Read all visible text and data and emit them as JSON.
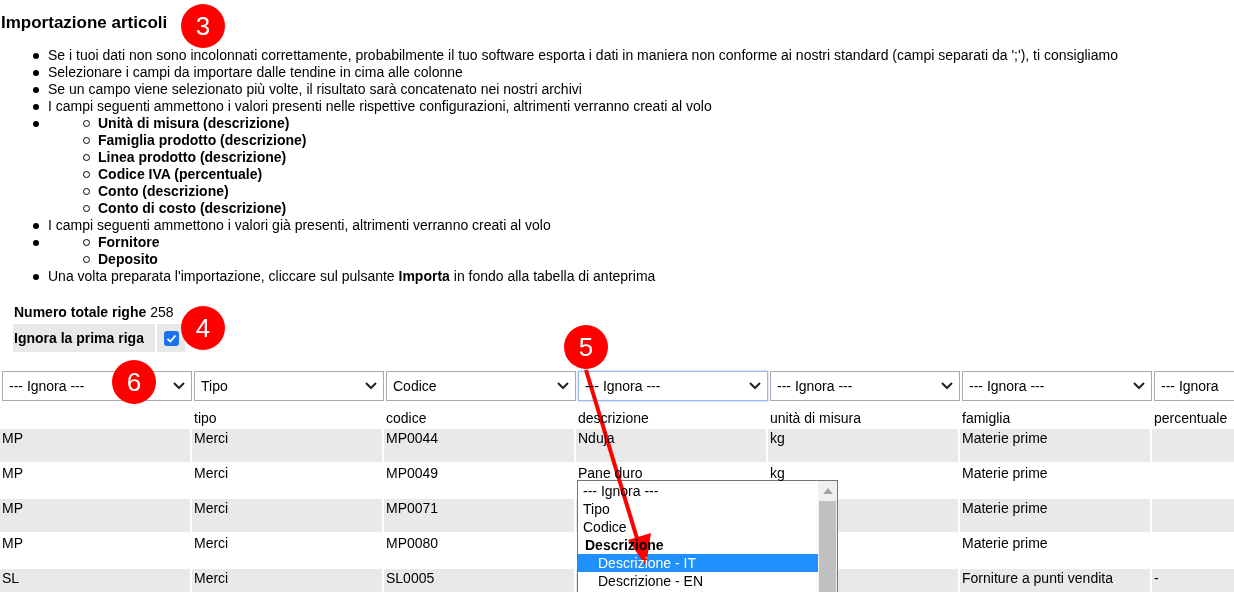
{
  "title": "Importazione articoli",
  "instructions": [
    {
      "kind": "text",
      "text": "Se i tuoi dati non sono incolonnati correttamente, probabilmente il tuo software esporta i dati in maniera non conforme ai nostri standard (campi separati da ';'), ti consigliamo"
    },
    {
      "kind": "text",
      "text": "Selezionare i campi da importare dalle tendine in cima alle colonne"
    },
    {
      "kind": "text",
      "text": "Se un campo viene selezionato più volte, il risultato sarà concatenato nei nostri archivi"
    },
    {
      "kind": "text",
      "text": "I campi seguenti ammettono i valori presenti nelle rispettive configurazioni, altrimenti verranno creati al volo"
    },
    {
      "kind": "sublist",
      "children": [
        "Unità di misura (descrizione)",
        "Famiglia prodotto (descrizione)",
        "Linea prodotto (descrizione)",
        "Codice IVA (percentuale)",
        "Conto (descrizione)",
        "Conto di costo (descrizione)"
      ]
    },
    {
      "kind": "text",
      "text": "I campi seguenti ammettono i valori già presenti, altrimenti verranno creati al volo"
    },
    {
      "kind": "sublist",
      "children": [
        "Fornitore",
        "Deposito"
      ]
    },
    {
      "kind": "text",
      "text": "Una volta preparata l'importazione, cliccare sul pulsante **Importa** in fondo alla tabella di anteprima"
    }
  ],
  "total_rows": {
    "label": "Numero totale righe",
    "value": "258"
  },
  "skip_first_row": {
    "label": "Ignora la prima riga",
    "checked": true
  },
  "columns": [
    {
      "select": "--- Ignora ---",
      "focused": false
    },
    {
      "select": "Tipo",
      "focused": false,
      "header": "tipo"
    },
    {
      "select": "Codice",
      "focused": false,
      "header": "codice"
    },
    {
      "select": "--- Ignora ---",
      "focused": true,
      "header": "descrizione"
    },
    {
      "select": "--- Ignora ---",
      "focused": false,
      "header": "unità di misura"
    },
    {
      "select": "--- Ignora ---",
      "focused": false,
      "header": "famiglia"
    },
    {
      "select": "--- Ignora",
      "focused": false,
      "header": "percentuale"
    }
  ],
  "rows": [
    [
      "MP",
      "Merci",
      "MP0044",
      "Nduja",
      "kg",
      "Materie prime",
      null
    ],
    [
      "MP",
      "Merci",
      "MP0049",
      "Pane duro",
      "kg",
      "Materie prime",
      null
    ],
    [
      "MP",
      "Merci",
      "MP0071",
      null,
      null,
      "Materie prime",
      null
    ],
    [
      "MP",
      "Merci",
      "MP0080",
      null,
      null,
      "Materie prime",
      null
    ],
    [
      "SL",
      "Merci",
      "SL0005",
      null,
      null,
      "Forniture a punti vendita",
      "-"
    ]
  ],
  "dropdown": {
    "options": [
      {
        "kind": "option",
        "label": "--- Ignora ---",
        "selected": false
      },
      {
        "kind": "option",
        "label": "Tipo",
        "selected": false
      },
      {
        "kind": "option",
        "label": "Codice",
        "selected": false
      },
      {
        "kind": "group",
        "label": "Descrizione",
        "selected": false
      },
      {
        "kind": "suboption",
        "label": "Descrizione - IT",
        "selected": true
      },
      {
        "kind": "suboption",
        "label": "Descrizione - EN",
        "selected": false
      }
    ]
  },
  "annotations": [
    {
      "label": "3"
    },
    {
      "label": "4"
    },
    {
      "label": "5"
    },
    {
      "label": "6"
    }
  ]
}
